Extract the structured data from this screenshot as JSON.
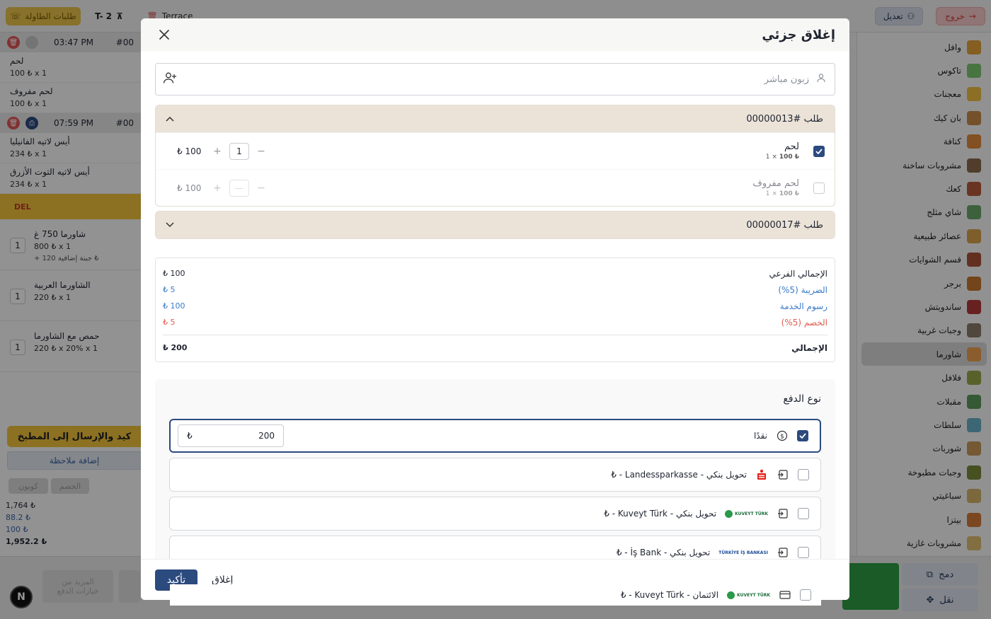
{
  "background": {
    "top": {
      "table_requests": "طلبات الطاولة",
      "table_name": "T- 2",
      "area": "Terrace",
      "exit": "خروج",
      "edit": "تعديل"
    },
    "left": {
      "groups": [
        {
          "time": "03:47 PM",
          "order_no": "#00",
          "items": [
            {
              "name": "لحم",
              "meta": "100 ₺  x 1"
            },
            {
              "name": "لحم مفروف",
              "meta": "100 ₺  x 1"
            }
          ]
        },
        {
          "time": "07:59 PM",
          "order_no": "#00",
          "items": [
            {
              "name": "أيس لاتيه الفانيليا",
              "meta": "234 ₺  x 1"
            },
            {
              "name": "أيس لاتيه التوت الأزرق",
              "meta": "234 ₺  x 1"
            }
          ]
        }
      ],
      "del_label": "DEL",
      "order_items": [
        {
          "qty": "1",
          "name": "شاورما 750 غ",
          "sub": "800 ₺  x 1",
          "extra": "+ جبنة إضافية  120 ₺"
        },
        {
          "qty": "1",
          "name": "الشاورما العربية",
          "sub": "220 ₺  x 1",
          "extra": ""
        },
        {
          "qty": "1",
          "name": "حمص مع الشاورما",
          "sub": "220 ₺  x 20%  x 1",
          "extra": ""
        }
      ],
      "kitchen_btn": "كيد والإرسال إلى المطبخ",
      "note_btn": "إضافة ملاحظة",
      "coupon": "كوبون",
      "discount": "الخصم",
      "totals": [
        "1,764 ₺",
        "88.2 ₺",
        "100 ₺",
        "1,952.2 ₺"
      ]
    },
    "bottom": {
      "more_payment": "المزيد من\nخيارات الدفع",
      "merge": "دمج",
      "move": "نقل",
      "n_badge": "N"
    },
    "categories": [
      "وافل",
      "تاكوس",
      "معجنات",
      "بان كيك",
      "كنافة",
      "مشروبات ساخنة",
      "كعك",
      "شاي مثلج",
      "عصائر طبيعية",
      "قسم الشوايات",
      "برجر",
      "ساندويتش",
      "وجبات غربية",
      "شاورما",
      "فلافل",
      "مقبلات",
      "سلطات",
      "شوربات",
      "وجبات مطبوخة",
      "سباغيتي",
      "بيتزا",
      "مشروبات غازية"
    ],
    "active_category": "شاورما"
  },
  "modal": {
    "title": "إغلاق جزئي",
    "customer_placeholder": "زبون مباشر",
    "orders": [
      {
        "label": "طلب #00000013",
        "expanded": true,
        "items": [
          {
            "name": "لحم",
            "unit": "100 ₺",
            "qty_text": "1 ×",
            "qty": "1",
            "price": "₺ 100",
            "checked": true
          },
          {
            "name": "لحم مفروف",
            "unit": "100 ₺",
            "qty_text": "1 ×",
            "qty": "—",
            "price": "₺ 100",
            "checked": false
          }
        ]
      },
      {
        "label": "طلب #00000017",
        "expanded": false,
        "items": []
      }
    ],
    "summary": {
      "subtotal_label": "الإجمالي الفرعي",
      "subtotal": "₺ 100",
      "tax_label": "الضريبة (5%)",
      "tax": "₺ 5",
      "service_label": "رسوم الخدمة",
      "service": "₺ 100",
      "discount_label": "الخصم (5%)",
      "discount": "₺ 5",
      "total_label": "الإجمالي",
      "total": "₺ 200"
    },
    "payment": {
      "title": "نوع الدفع",
      "methods": [
        {
          "label": "نقدًا",
          "checked": true,
          "amount": "200",
          "currency": "₺"
        },
        {
          "label": "تحويل بنكي - Landessparkasse - ₺",
          "checked": false
        },
        {
          "label": "تحويل بنكي - Kuveyt Türk - ₺",
          "checked": false
        },
        {
          "label": "تحويل بنكي - İş Bank - ₺",
          "checked": false
        },
        {
          "label": "الائتمان - Kuveyt Türk - ₺",
          "checked": false
        }
      ],
      "kt_logo": "KUVEYT TÜRK",
      "is_logo": "TÜRKİYE İŞ BANKASI"
    },
    "footer": {
      "confirm": "تأكيد",
      "close": "إغلاق"
    }
  },
  "colors": {
    "primary": "#2b4a7e",
    "tax_blue": "#3a7bc8",
    "discount_red": "#e0604f",
    "order_header": "#ebe3d8"
  }
}
